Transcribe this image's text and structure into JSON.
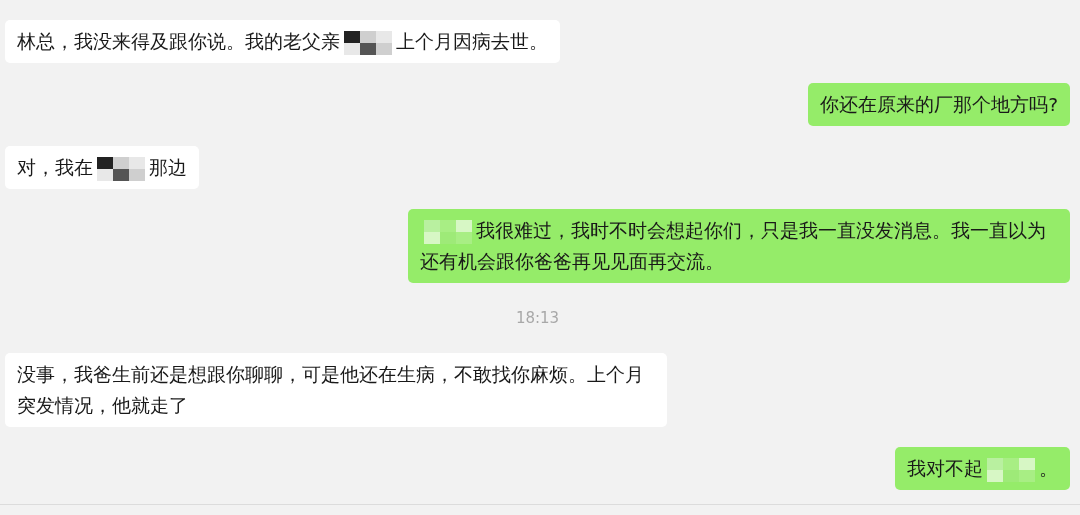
{
  "messages": [
    {
      "kind": "received",
      "parts": [
        {
          "kind": "text",
          "text": "林总，我没来得及跟你说。我的老父亲"
        },
        {
          "kind": "redaction"
        },
        {
          "kind": "text",
          "text": "上个月因病去世。"
        }
      ]
    },
    {
      "kind": "sent",
      "parts": [
        {
          "kind": "text",
          "text": "你还在原来的厂那个地方吗?"
        }
      ]
    },
    {
      "kind": "received",
      "parts": [
        {
          "kind": "text",
          "text": "对，我在"
        },
        {
          "kind": "redaction"
        },
        {
          "kind": "text",
          "text": "那边"
        }
      ]
    },
    {
      "kind": "sent",
      "parts": [
        {
          "kind": "redaction"
        },
        {
          "kind": "text",
          "text": "我很难过，我时不时会想起你们，只是我一直没发消息。我一直以为还有机会跟你爸爸再见见面再交流。"
        }
      ]
    },
    {
      "kind": "time",
      "text": "18:13"
    },
    {
      "kind": "received",
      "parts": [
        {
          "kind": "text",
          "text": "没事，我爸生前还是想跟你聊聊，可是他还在生病，不敢找你麻烦。上个月突发情况，他就走了"
        }
      ]
    },
    {
      "kind": "sent",
      "parts": [
        {
          "kind": "text",
          "text": "我对不起"
        },
        {
          "kind": "redaction"
        },
        {
          "kind": "text",
          "text": "。"
        }
      ]
    }
  ]
}
